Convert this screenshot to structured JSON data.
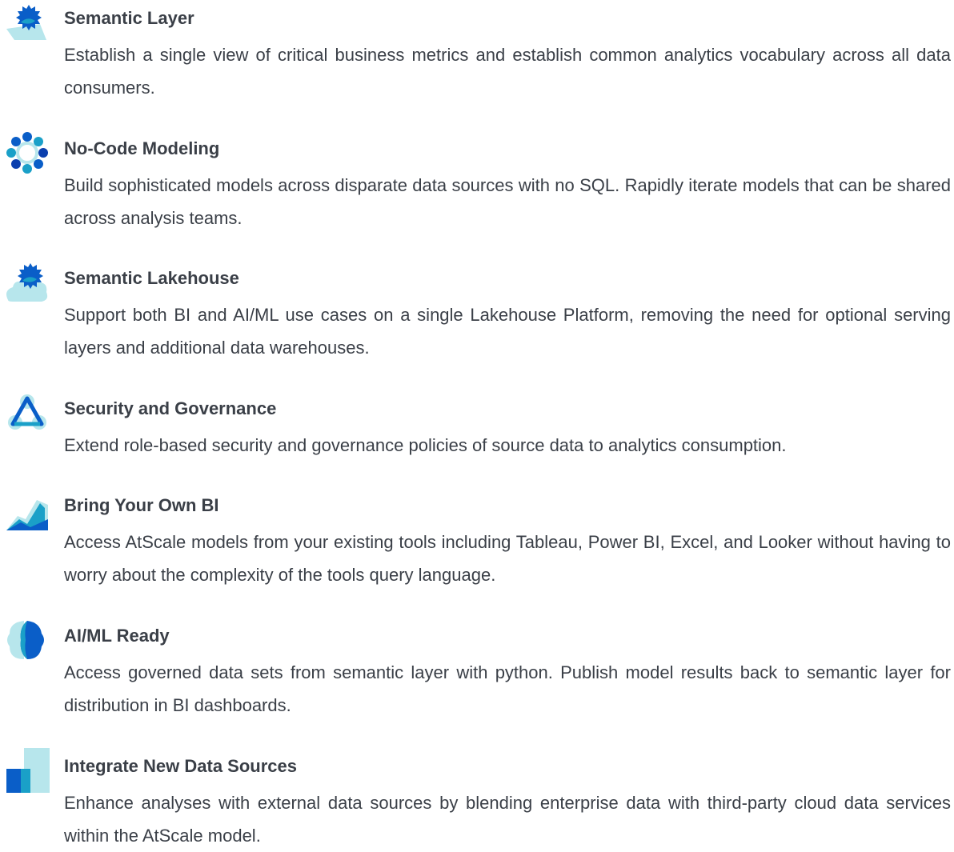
{
  "colors": {
    "text": "#3a3f47",
    "brand_blue": "#0a5ec8",
    "dark_blue": "#0b3fae",
    "teal": "#1aa0c8",
    "light_teal": "#b7e6ec"
  },
  "features": [
    {
      "icon": "semantic-layer-icon",
      "title": "Semantic Layer",
      "description": "Establish a single view of critical business metrics and establish common analytics vocabulary across all data consumers."
    },
    {
      "icon": "no-code-modeling-icon",
      "title": "No-Code Modeling",
      "description": "Build sophisticated models across disparate data sources with no SQL. Rapidly iterate models that can be shared across analysis teams."
    },
    {
      "icon": "semantic-lakehouse-icon",
      "title": "Semantic Lakehouse",
      "description": "Support both BI and AI/ML use cases on a single Lakehouse Platform, removing the need for optional serving layers and additional data warehouses."
    },
    {
      "icon": "security-governance-icon",
      "title": "Security and Governance",
      "description": "Extend role-based security and governance policies of source data to analytics consumption."
    },
    {
      "icon": "bring-your-own-bi-icon",
      "title": "Bring Your Own BI",
      "description": "Access AtScale models from your existing tools including Tableau, Power BI, Excel, and Looker without having to worry about the complexity of the tools query language."
    },
    {
      "icon": "ai-ml-ready-icon",
      "title": "AI/ML Ready",
      "description": "Access governed data sets from semantic layer with python. Publish model results back to semantic layer for distribution in BI dashboards."
    },
    {
      "icon": "integrate-data-sources-icon",
      "title": "Integrate New Data Sources",
      "description": "Enhance analyses with external data sources by blending enterprise data with third-party cloud data services within the AtScale model."
    }
  ]
}
